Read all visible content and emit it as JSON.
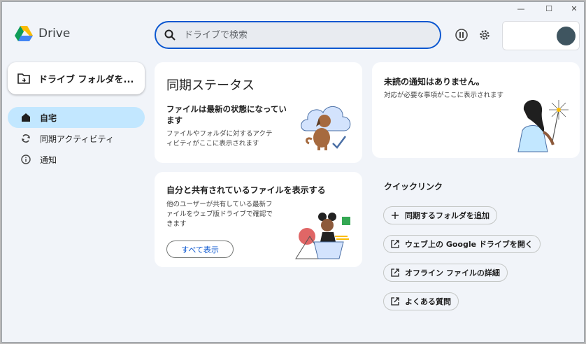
{
  "app": {
    "name": "Drive"
  },
  "window": {
    "minimize": "—",
    "maximize": "☐",
    "close": "✕"
  },
  "search": {
    "placeholder": "ドライブで検索"
  },
  "sidebar": {
    "new_folder": "ドライブ フォルダを...",
    "items": [
      {
        "label": "自宅",
        "icon": "home-icon",
        "active": true
      },
      {
        "label": "同期アクティビティ",
        "icon": "sync-icon",
        "active": false
      },
      {
        "label": "通知",
        "icon": "info-icon",
        "active": false
      }
    ]
  },
  "sync_card": {
    "title": "同期ステータス",
    "status": "ファイルは最新の状態になっています",
    "description": "ファイルやフォルダに対するアクティビティがここに表示されます"
  },
  "shared_card": {
    "title": "自分と共有されているファイルを表示する",
    "description": "他のユーザーが共有している最新ファイルをウェブ版ドライブで確認できます",
    "button": "すべて表示"
  },
  "notif_card": {
    "title": "未読の通知はありません。",
    "description": "対応が必要な事項がここに表示されます"
  },
  "quick_links": {
    "title": "クイックリンク",
    "items": [
      {
        "label": "同期するフォルダを追加",
        "icon": "plus-icon"
      },
      {
        "label": "ウェブ上の Google ドライブを開く",
        "icon": "open-external-icon"
      },
      {
        "label": "オフライン ファイルの詳細",
        "icon": "open-external-icon"
      },
      {
        "label": "よくある質問",
        "icon": "open-external-icon"
      }
    ]
  },
  "colors": {
    "accent": "#0b57d0",
    "active_nav": "#c2e7ff",
    "background": "#f1f4f9"
  }
}
